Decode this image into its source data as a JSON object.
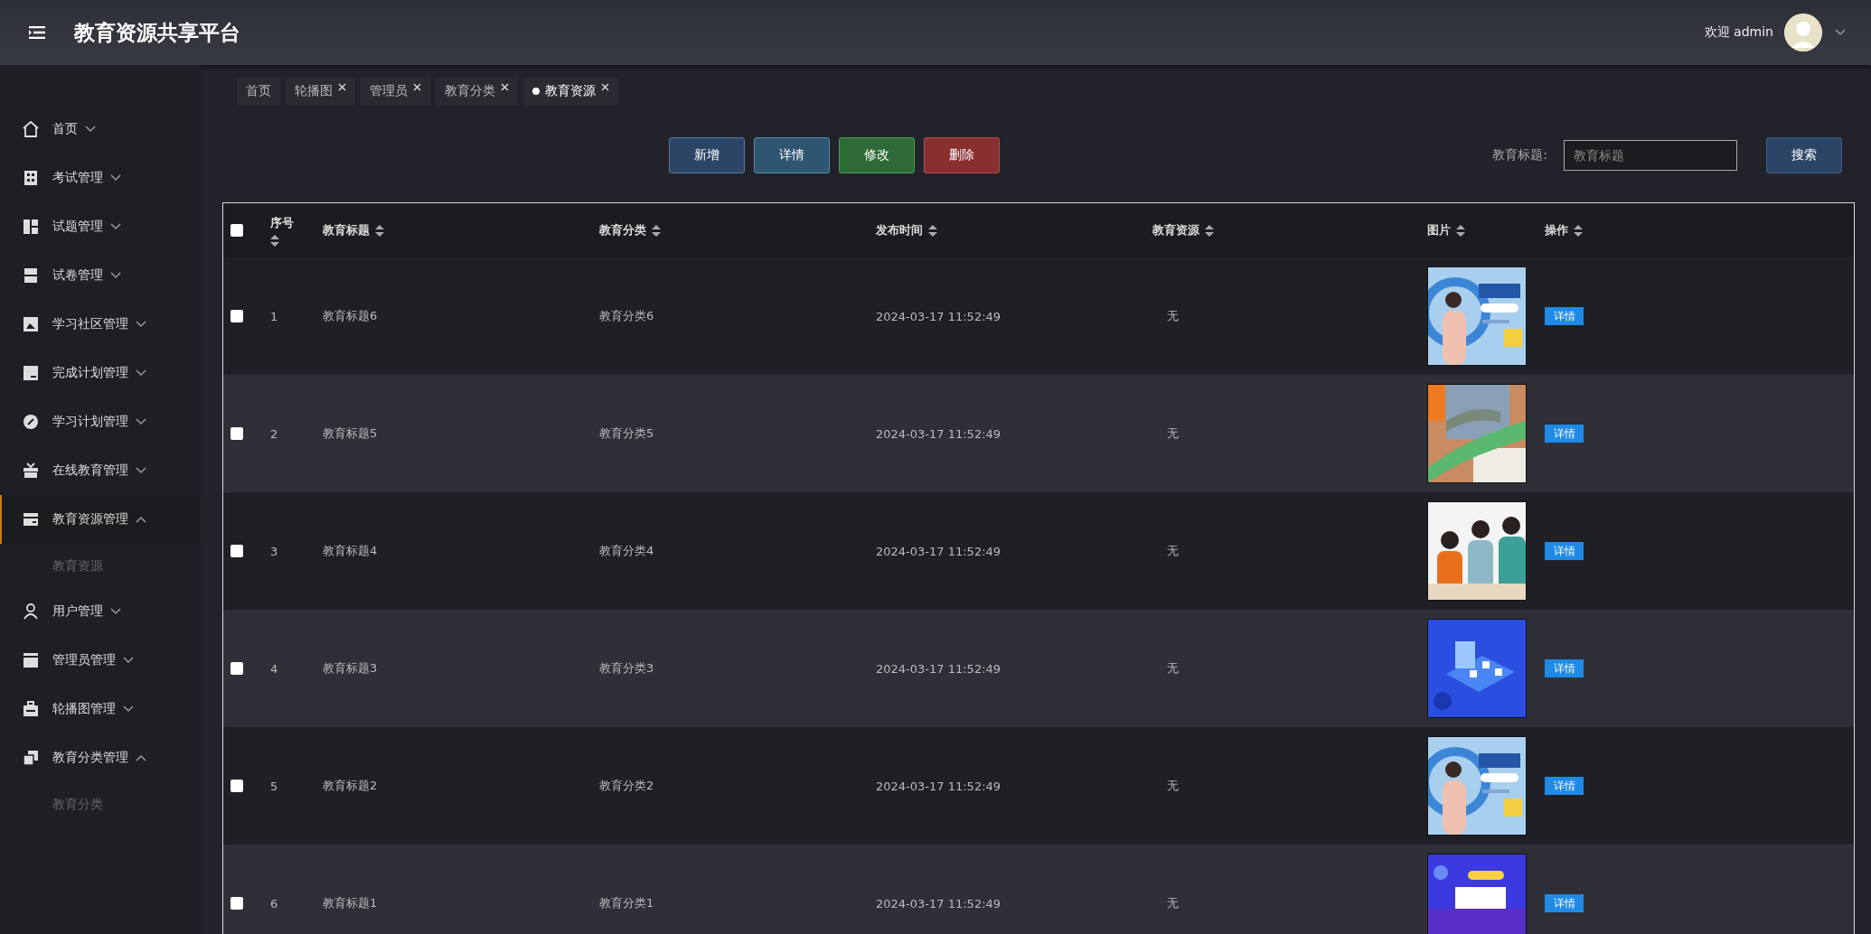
{
  "header": {
    "title": "教育资源共享平台",
    "welcome": "欢迎 admin"
  },
  "sidebar": {
    "items": [
      {
        "label": "首页",
        "expanded": false,
        "active": false
      },
      {
        "label": "考试管理",
        "expanded": false,
        "active": false
      },
      {
        "label": "试题管理",
        "expanded": false,
        "active": false
      },
      {
        "label": "试卷管理",
        "expanded": false,
        "active": false
      },
      {
        "label": "学习社区管理",
        "expanded": false,
        "active": false
      },
      {
        "label": "完成计划管理",
        "expanded": false,
        "active": false
      },
      {
        "label": "学习计划管理",
        "expanded": false,
        "active": false
      },
      {
        "label": "在线教育管理",
        "expanded": false,
        "active": false
      },
      {
        "label": "教育资源管理",
        "expanded": true,
        "active": true,
        "children": [
          {
            "label": "教育资源"
          }
        ]
      },
      {
        "label": "用户管理",
        "expanded": false,
        "active": false
      },
      {
        "label": "管理员管理",
        "expanded": false,
        "active": false
      },
      {
        "label": "轮播图管理",
        "expanded": false,
        "active": false
      },
      {
        "label": "教育分类管理",
        "expanded": true,
        "active": false,
        "children": [
          {
            "label": "教育分类"
          }
        ]
      }
    ]
  },
  "tabs": [
    {
      "label": "首页",
      "selected": false,
      "closable": false
    },
    {
      "label": "轮播图",
      "selected": false,
      "closable": true
    },
    {
      "label": "管理员",
      "selected": false,
      "closable": true
    },
    {
      "label": "教育分类",
      "selected": false,
      "closable": true
    },
    {
      "label": "教育资源",
      "selected": true,
      "closable": true
    }
  ],
  "toolbar": {
    "buttons": [
      {
        "label": "新增",
        "kind": "add"
      },
      {
        "label": "详情",
        "kind": "detail"
      },
      {
        "label": "修改",
        "kind": "edit"
      },
      {
        "label": "删除",
        "kind": "delete"
      }
    ],
    "search_label": "教育标题:",
    "search_placeholder": "教育标题",
    "search_button": "搜索"
  },
  "table": {
    "select_all_checked": false,
    "columns": [
      {
        "label": "序号",
        "sortable": true
      },
      {
        "label": "教育标题",
        "sortable": true
      },
      {
        "label": "教育分类",
        "sortable": true
      },
      {
        "label": "发布时间",
        "sortable": true
      },
      {
        "label": "教育资源",
        "sortable": true
      },
      {
        "label": "图片",
        "sortable": true
      },
      {
        "label": "操作",
        "sortable": true
      }
    ],
    "rows": [
      {
        "checked": false,
        "index": "1",
        "title": "教育标题6",
        "category": "教育分类6",
        "time": "2024-03-17 11:52:49",
        "resource": "无",
        "action": "详情"
      },
      {
        "checked": false,
        "index": "2",
        "title": "教育标题5",
        "category": "教育分类5",
        "time": "2024-03-17 11:52:49",
        "resource": "无",
        "action": "详情"
      },
      {
        "checked": false,
        "index": "3",
        "title": "教育标题4",
        "category": "教育分类4",
        "time": "2024-03-17 11:52:49",
        "resource": "无",
        "action": "详情"
      },
      {
        "checked": false,
        "index": "4",
        "title": "教育标题3",
        "category": "教育分类3",
        "time": "2024-03-17 11:52:49",
        "resource": "无",
        "action": "详情"
      },
      {
        "checked": false,
        "index": "5",
        "title": "教育标题2",
        "category": "教育分类2",
        "time": "2024-03-17 11:52:49",
        "resource": "无",
        "action": "详情"
      },
      {
        "checked": false,
        "index": "6",
        "title": "教育标题1",
        "category": "教育分类1",
        "time": "2024-03-17 11:52:49",
        "resource": "无",
        "action": "详情"
      }
    ]
  }
}
